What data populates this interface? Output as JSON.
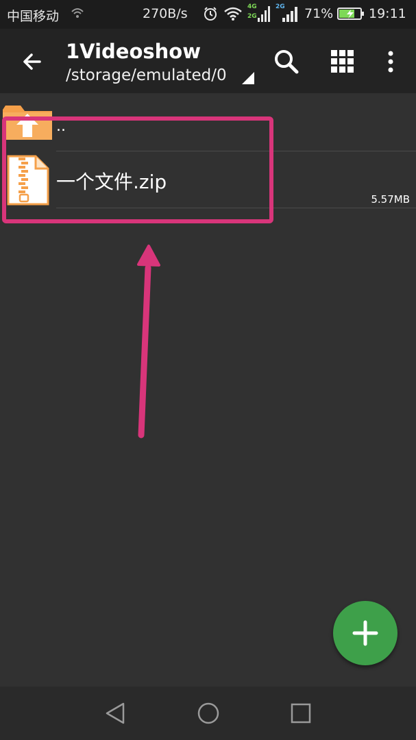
{
  "status_bar": {
    "carrier": "中国移动",
    "net_speed": "270B/s",
    "net_4g_label": "4G",
    "net_2g_label_a": "2G",
    "net_2g_label_b": "2G",
    "battery_percent": "71%",
    "time": "19:11",
    "icons": [
      "wifi-small-icon",
      "alarm-icon",
      "wifi-icon",
      "signal-4g-icon",
      "signal-2g-icon",
      "battery-charging-icon"
    ]
  },
  "toolbar": {
    "title": "1Videoshow",
    "path": "/storage/emulated/0",
    "icons": [
      "back-arrow-icon",
      "search-icon",
      "grid-view-icon",
      "more-vert-icon"
    ]
  },
  "files": {
    "parent": {
      "name": "..",
      "icon": "folder-up-icon"
    },
    "items": [
      {
        "name": "一个文件.zip",
        "size": "5.57MB",
        "icon": "zip-file-icon"
      }
    ]
  },
  "fab": {
    "icon": "plus-icon"
  },
  "nav_bar": {
    "icons": [
      "nav-back-icon",
      "nav-home-icon",
      "nav-recent-icon"
    ]
  },
  "colors": {
    "background": "#313131",
    "toolbar": "#232323",
    "status_bar": "#1c1c1c",
    "annotation": "#d8357a",
    "fab": "#3ea04a",
    "folder": "#f5a04a",
    "zip_icon": "#f5a04a"
  }
}
